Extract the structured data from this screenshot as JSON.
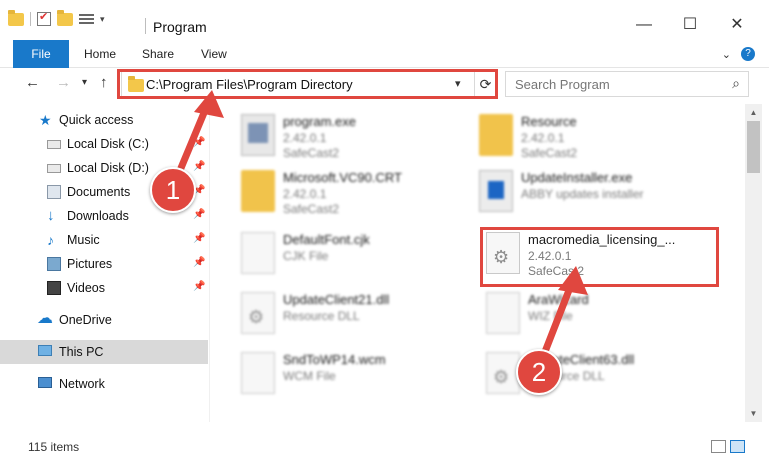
{
  "window": {
    "title": "Program"
  },
  "ribbon": {
    "file_tab": "File",
    "tabs": [
      "Home",
      "Share",
      "View"
    ]
  },
  "address": {
    "path": "C:\\Program Files\\Program Directory"
  },
  "search": {
    "placeholder": "Search Program"
  },
  "sidebar": {
    "items": [
      {
        "label": "Quick access",
        "icon": "star-icon"
      },
      {
        "label": "Local Disk (C:)",
        "icon": "drive-icon",
        "pinned": true
      },
      {
        "label": "Local Disk (D:)",
        "icon": "drive-icon",
        "pinned": true
      },
      {
        "label": "Documents",
        "icon": "documents-icon",
        "pinned": true
      },
      {
        "label": "Downloads",
        "icon": "download-icon",
        "pinned": true
      },
      {
        "label": "Music",
        "icon": "music-icon",
        "pinned": true
      },
      {
        "label": "Pictures",
        "icon": "pictures-icon",
        "pinned": true
      },
      {
        "label": "Videos",
        "icon": "videos-icon",
        "pinned": true
      },
      {
        "label": "OneDrive",
        "icon": "onedrive-icon"
      },
      {
        "label": "This PC",
        "icon": "pc-icon",
        "selected": true
      },
      {
        "label": "Network",
        "icon": "network-icon"
      }
    ]
  },
  "files": [
    {
      "name": "program.exe",
      "line1": "2.42.0.1",
      "line2": "SafeCast2"
    },
    {
      "name": "Resource",
      "line1": "2.42.0.1",
      "line2": "SafeCast2"
    },
    {
      "name": "Microsoft.VC90.CRT",
      "line1": "2.42.0.1",
      "line2": "SafeCast2"
    },
    {
      "name": "UpdateInstaller.exe",
      "line1": "ABBY updates installer",
      "line2": ""
    },
    {
      "name": "DefaultFont.cjk",
      "line1": "CJK File",
      "line2": ""
    },
    {
      "name": "macromedia_licensing_...",
      "line1": "2.42.0.1",
      "line2": "SafeCast2"
    },
    {
      "name": "UpdateClient21.dll",
      "line1": "Resource DLL",
      "line2": ""
    },
    {
      "name": "AraWizard",
      "line1": "WIZ File",
      "line2": ""
    },
    {
      "name": "SndToWP14.wcm",
      "line1": "WCM File",
      "line2": ""
    },
    {
      "name": "UpdateClient63.dll",
      "line1": "Resource DLL",
      "line2": ""
    }
  ],
  "status": {
    "item_count": "115 items"
  },
  "annotations": {
    "step1": "1",
    "step2": "2",
    "accent_color": "#e0473f"
  },
  "colors": {
    "ribbon_file": "#1979ca",
    "selection": "#d9d9d9"
  }
}
